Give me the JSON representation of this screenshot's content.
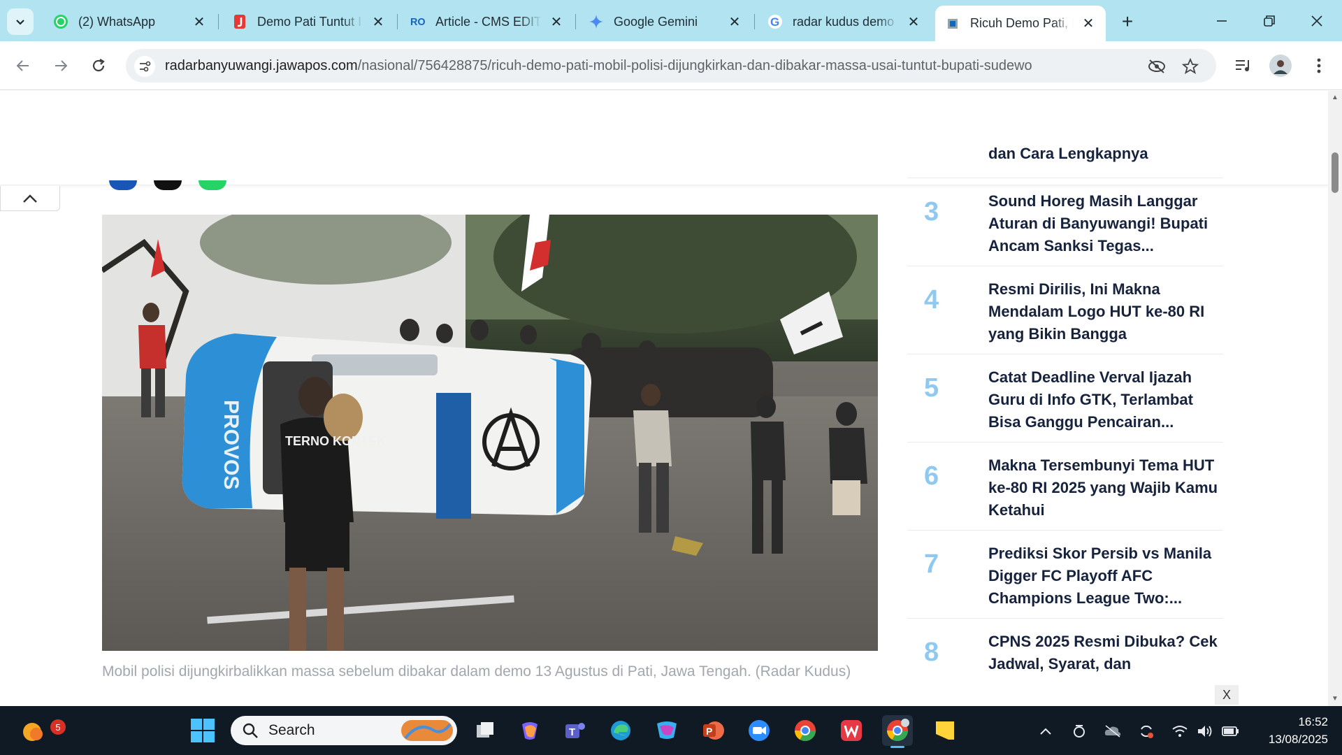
{
  "browser": {
    "tabs": [
      {
        "title": "(2) WhatsApp",
        "icon": "whatsapp-icon",
        "active": false
      },
      {
        "title": "Demo Pati Tuntut I",
        "icon": "jawapos-icon",
        "active": false
      },
      {
        "title": "Article - CMS EDITO",
        "icon": "cms-icon",
        "active": false
      },
      {
        "title": "Google Gemini",
        "icon": "gemini-icon",
        "active": false
      },
      {
        "title": "radar kudus demo",
        "icon": "google-icon",
        "active": false
      },
      {
        "title": "Ricuh Demo Pati, M",
        "icon": "radar-icon",
        "active": true
      }
    ],
    "url_domain": "radarbanyuwangi.jawapos.com",
    "url_path": "/nasional/756428875/ricuh-demo-pati-mobil-polisi-dijungkirkan-dan-dibakar-massa-usai-tuntut-bupati-sudewo"
  },
  "article": {
    "caption": "Mobil polisi dijungkirbalikkan massa sebelum dibakar dalam demo 13 Agustus di Pati, Jawa Tengah. (Radar Kudus)",
    "photo_text": {
      "van": "PROVOS",
      "shirt": "TERNO KONTEK"
    }
  },
  "trending": {
    "partial_title": "dan Cara Lengkapnya",
    "items": [
      {
        "rank": "3",
        "title": "Sound Horeg Masih Langgar Aturan di Banyuwangi! Bupati Ancam Sanksi Tegas..."
      },
      {
        "rank": "4",
        "title": "Resmi Dirilis, Ini Makna Mendalam Logo HUT ke-80 RI yang Bikin Bangga"
      },
      {
        "rank": "5",
        "title": "Catat Deadline Verval Ijazah Guru di Info GTK, Terlambat Bisa Ganggu Pencairan..."
      },
      {
        "rank": "6",
        "title": "Makna Tersembunyi Tema HUT ke-80 RI 2025 yang Wajib Kamu Ketahui"
      },
      {
        "rank": "7",
        "title": "Prediksi Skor Persib vs Manila Digger FC Playoff AFC Champions League Two:..."
      },
      {
        "rank": "8",
        "title": "CPNS 2025 Resmi Dibuka? Cek Jadwal, Syarat, dan"
      }
    ],
    "ad_close": "X"
  },
  "taskbar": {
    "search_label": "Search",
    "notification_count": "5",
    "time": "16:52",
    "date": "13/08/2025"
  },
  "colors": {
    "tabstrip": "#b2e3f0",
    "rank_number": "#8fc9f0",
    "headline": "#17233d",
    "caption": "#a1a7ad",
    "taskbar": "#101a24"
  }
}
